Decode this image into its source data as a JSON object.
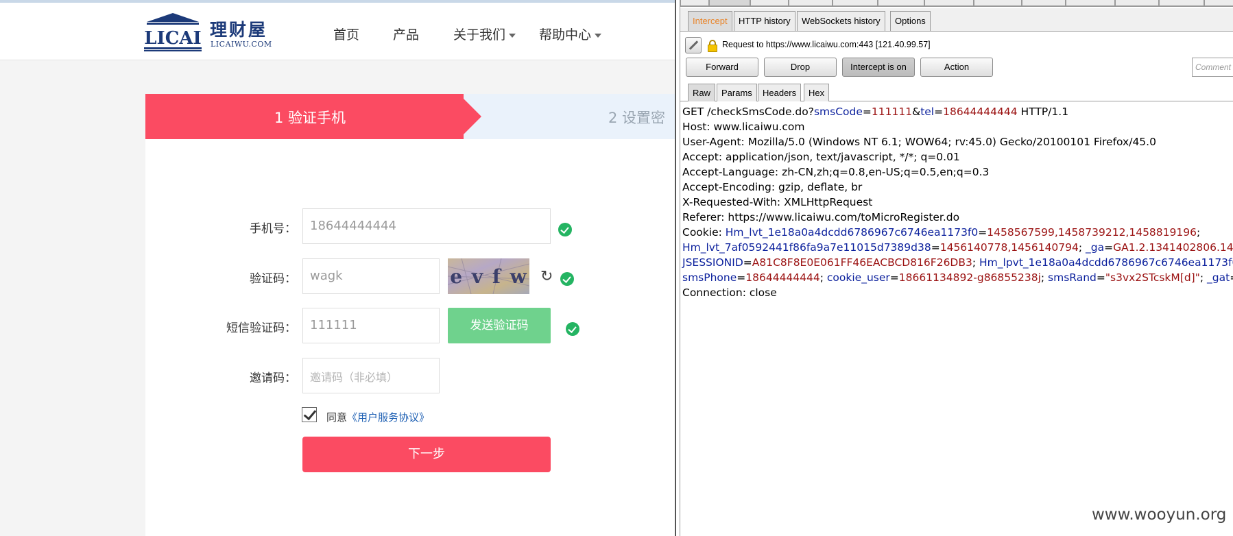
{
  "site": {
    "logo": {
      "mark_text": "LICAI",
      "cn": "理财屋",
      "en": "LICAIWU.COM"
    },
    "nav": {
      "home": "首页",
      "products": "产品",
      "about": "关于我们",
      "help": "帮助中心"
    },
    "steps": {
      "step1": "1  验证手机",
      "step2": "2  设置密"
    },
    "form": {
      "phone_label": "手机号：",
      "phone_value": "18644444444",
      "captcha_label": "验证码：",
      "captcha_value": "wagk",
      "captcha_image_text": "e v f w",
      "sms_label": "短信验证码：",
      "sms_value": "111111",
      "sms_button": "发送验证码",
      "invite_label": "邀请码：",
      "invite_placeholder": "邀请码（非必填）",
      "agree_text": "同意",
      "agree_link": "《用户服务协议》",
      "next_button": "下一步"
    },
    "colors": {
      "accent": "#fb4b62",
      "success": "#24b462",
      "sms_button": "#6fd28d"
    }
  },
  "burp": {
    "subtabs": {
      "intercept": "Intercept",
      "http_history": "HTTP history",
      "websockets_history": "WebSockets history",
      "options": "Options"
    },
    "request_to": "Request to https://www.licaiwu.com:443  [121.40.99.57]",
    "buttons": {
      "forward": "Forward",
      "drop": "Drop",
      "intercept": "Intercept is on",
      "action": "Action"
    },
    "comment_placeholder": "Comment",
    "msg_tabs": {
      "raw": "Raw",
      "params": "Params",
      "headers": "Headers",
      "hex": "Hex"
    },
    "raw": [
      [
        [
          "t",
          "GET /checkSmsCode.do?"
        ],
        [
          "k",
          "smsCode"
        ],
        [
          "t",
          "="
        ],
        [
          "v",
          "111111"
        ],
        [
          "t",
          "&"
        ],
        [
          "k",
          "tel"
        ],
        [
          "t",
          "="
        ],
        [
          "v",
          "18644444444"
        ],
        [
          "t",
          " HTTP/1.1"
        ]
      ],
      [
        [
          "t",
          "Host: www.licaiwu.com"
        ]
      ],
      [
        [
          "t",
          "User-Agent: Mozilla/5.0 (Windows NT 6.1; WOW64; rv:45.0) Gecko/20100101 Firefox/45.0"
        ]
      ],
      [
        [
          "t",
          "Accept: application/json, text/javascript, */*; q=0.01"
        ]
      ],
      [
        [
          "t",
          "Accept-Language: zh-CN,zh;q=0.8,en-US;q=0.5,en;q=0.3"
        ]
      ],
      [
        [
          "t",
          "Accept-Encoding: gzip, deflate, br"
        ]
      ],
      [
        [
          "t",
          "X-Requested-With: XMLHttpRequest"
        ]
      ],
      [
        [
          "t",
          "Referer: https://www.licaiwu.com/toMicroRegister.do"
        ]
      ],
      [
        [
          "t",
          "Cookie: "
        ],
        [
          "k",
          "Hm_lvt_1e18a0a4dcdd6786967c6746ea1173f0"
        ],
        [
          "t",
          "="
        ],
        [
          "v",
          "1458567599,1458739212,1458819196"
        ],
        [
          "t",
          ";"
        ]
      ],
      [
        [
          "k",
          "Hm_lvt_7af0592441f86fa9a7e11015d7389d38"
        ],
        [
          "t",
          "="
        ],
        [
          "v",
          "1456140778,1456140794"
        ],
        [
          "t",
          "; "
        ],
        [
          "k",
          "_ga"
        ],
        [
          "t",
          "="
        ],
        [
          "v",
          "GA1.2.1341402806.1456140778"
        ]
      ],
      [
        [
          "k",
          "JSESSIONID"
        ],
        [
          "t",
          "="
        ],
        [
          "v",
          "A81C8F8E0E061FF46EACBCD816F26DB3"
        ],
        [
          "t",
          "; "
        ],
        [
          "k",
          "Hm_lpvt_1e18a0a4dcdd6786967c6746ea1173f0"
        ],
        [
          "t",
          "="
        ],
        [
          "v",
          "14"
        ]
      ],
      [
        [
          "k",
          "smsPhone"
        ],
        [
          "t",
          "="
        ],
        [
          "v",
          "18644444444"
        ],
        [
          "t",
          "; "
        ],
        [
          "k",
          "cookie_user"
        ],
        [
          "t",
          "="
        ],
        [
          "v",
          "18661134892-g86855238j"
        ],
        [
          "t",
          "; "
        ],
        [
          "k",
          "smsRand"
        ],
        [
          "t",
          "="
        ],
        [
          "v",
          "\"s3vx2STcskM[d]\""
        ],
        [
          "t",
          "; "
        ],
        [
          "k",
          "_gat"
        ],
        [
          "t",
          "="
        ],
        [
          "v",
          "1"
        ]
      ],
      [
        [
          "t",
          "Connection: close"
        ]
      ]
    ],
    "colors": {
      "header_key": "#0a1f9c",
      "header_value": "#9b1212",
      "active_tab_text": "#e8842a"
    }
  },
  "watermark": "www.wooyun.org"
}
